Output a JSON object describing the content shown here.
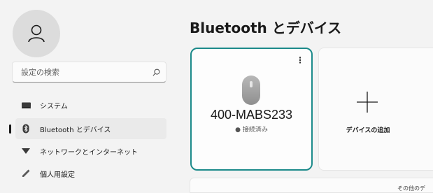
{
  "sidebar": {
    "search_placeholder": "設定の検索",
    "items": [
      {
        "label": "システム",
        "icon": "system-icon",
        "active": false
      },
      {
        "label": "Bluetooth とデバイス",
        "icon": "bluetooth-icon",
        "active": true
      },
      {
        "label": "ネットワークとインターネット",
        "icon": "wifi-icon",
        "active": false
      },
      {
        "label": "個人用設定",
        "icon": "pen-icon",
        "active": false
      }
    ]
  },
  "main": {
    "title": "Bluetooth とデバイス",
    "device_card": {
      "name": "400-MABS233",
      "status": "● 接続済み",
      "menu_glyph": "⋮"
    },
    "add_card": {
      "label": "デバイスの追加"
    },
    "bottom_text": "その他のデ"
  },
  "colors": {
    "accent": "#1c8a8a",
    "background": "#f3f3f3"
  }
}
